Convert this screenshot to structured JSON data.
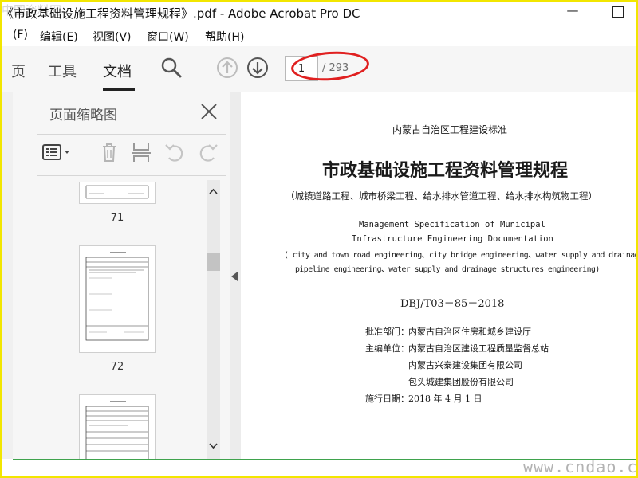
{
  "window": {
    "title": "《市政基础设施工程资料管理规程》.pdf - Adobe Acrobat Pro DC",
    "watermark_top": "中国资料网",
    "minimize": "—"
  },
  "menu": [
    "(F)",
    "编辑(E)",
    "视图(V)",
    "窗口(W)",
    "帮助(H)"
  ],
  "toolbar": {
    "tab_home": "页",
    "tab_tools": "工具",
    "tab_document": "文档",
    "current_page": "1",
    "total_pages": "/ 293"
  },
  "thumbnails_panel": {
    "title": "页面缩略图",
    "pages": [
      "71",
      "72"
    ]
  },
  "document": {
    "issuer": "内蒙古自治区工程建设标准",
    "title": "市政基础设施工程资料管理规程",
    "subtitle": "（城镇道路工程、城市桥梁工程、给水排水管道工程、给水排水构筑物工程）",
    "en_line1": "Management Specification of Municipal",
    "en_line2": "Infrastructure Engineering Documentation",
    "en_line3": "( city and town road engineering、city bridge engineering、water supply and drainage",
    "en_line4": "pipeline  engineering、water supply and drainage structures engineering)",
    "code": "DBJ/T03－85－2018",
    "approval_label": "批准部门：",
    "approval_value": "内蒙古自治区住房和城乡建设厅",
    "editor_label": "主编单位：",
    "editor_value1": "内蒙古自治区建设工程质量监督总站",
    "editor_value2": "内蒙古兴泰建设集团有限公司",
    "editor_value3": "包头城建集团股份有限公司",
    "date_label": "施行日期：",
    "date_value": "2018 年 4 月 1 日"
  },
  "footer": {
    "watermark": "www.cndao.com"
  },
  "colors": {
    "highlight_ellipse": "#e02020",
    "frame_border": "#f2e600",
    "green_rule": "#3fa34d"
  }
}
